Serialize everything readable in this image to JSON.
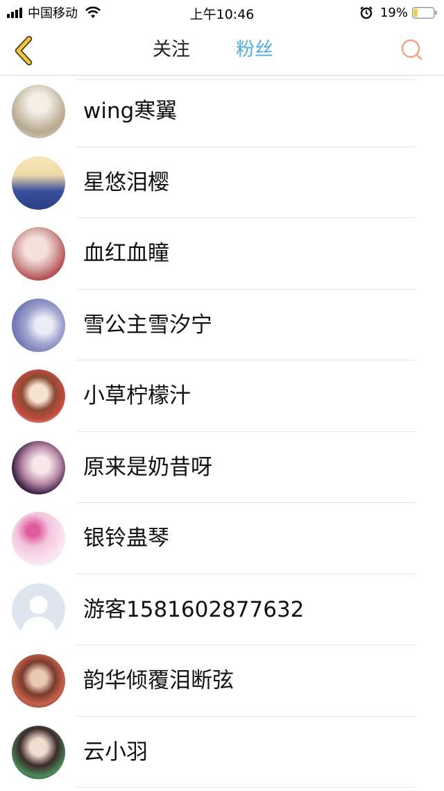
{
  "status_bar": {
    "carrier": "中国移动",
    "time": "上午10:46",
    "battery_percent": "19%",
    "battery_level": 0.19
  },
  "nav": {
    "back_icon": "chevron-left-icon",
    "tabs": [
      {
        "label": "关注",
        "active": false
      },
      {
        "label": "粉丝",
        "active": true
      }
    ],
    "search_icon": "search-icon",
    "accent_color": "#4aaede",
    "back_color": "#f2c53d",
    "search_color": "#f4a07a"
  },
  "fans": [
    {
      "name": "wing寒翼",
      "avatar": "anime-avatar"
    },
    {
      "name": "星悠泪樱",
      "avatar": "anime-avatar"
    },
    {
      "name": "血红血瞳",
      "avatar": "anime-avatar"
    },
    {
      "name": "雪公主雪汐宁",
      "avatar": "photo-avatar"
    },
    {
      "name": "小草柠檬汁",
      "avatar": "anime-avatar"
    },
    {
      "name": "原来是奶昔呀",
      "avatar": "anime-avatar"
    },
    {
      "name": "银铃蛊琴",
      "avatar": "anime-avatar"
    },
    {
      "name": "游客1581602877632",
      "avatar": "default-user-avatar"
    },
    {
      "name": "韵华倾覆泪断弦",
      "avatar": "anime-avatar"
    },
    {
      "name": "云小羽",
      "avatar": "anime-avatar"
    }
  ]
}
